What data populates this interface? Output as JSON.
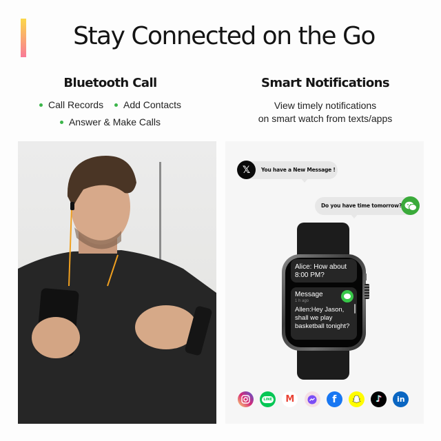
{
  "header": {
    "title": "Stay Connected on the Go",
    "accent_gradient": [
      "#fbd84a",
      "#f97a98"
    ]
  },
  "bluetooth": {
    "heading": "Bluetooth Call",
    "bullets": [
      "Call Records",
      "Add Contacts",
      "Answer & Make Calls"
    ],
    "bullet_color": "#3bb54a"
  },
  "notifications": {
    "heading": "Smart Notifications",
    "description_line1": "View timely notifications",
    "description_line2": "on smart watch from texts/apps"
  },
  "chat": {
    "incoming": {
      "app_icon": "x-icon",
      "glyph": "𝕏",
      "text": "You have a New Message !"
    },
    "outgoing": {
      "app_icon": "wechat-icon",
      "text": "Do you have time tomorrow?"
    }
  },
  "watch_screen": {
    "card1": {
      "text": "Alice: How about 8:00 PM?"
    },
    "card2": {
      "title": "Message",
      "time": "1 h ago",
      "body": "Allen:Hey Jason, shall we play basketball tonight?"
    }
  },
  "social_apps": [
    {
      "name": "instagram",
      "color": "#d62976"
    },
    {
      "name": "line",
      "color": "#06c755",
      "label": "LINE"
    },
    {
      "name": "gmail",
      "color": "#ffffff",
      "label": "M"
    },
    {
      "name": "messenger",
      "color": "#f5dfe4"
    },
    {
      "name": "facebook",
      "color": "#1877f2",
      "label": "f"
    },
    {
      "name": "snapchat",
      "color": "#fffc00"
    },
    {
      "name": "tiktok",
      "color": "#000000"
    },
    {
      "name": "linkedin",
      "color": "#0a66c2",
      "label": "in"
    }
  ]
}
